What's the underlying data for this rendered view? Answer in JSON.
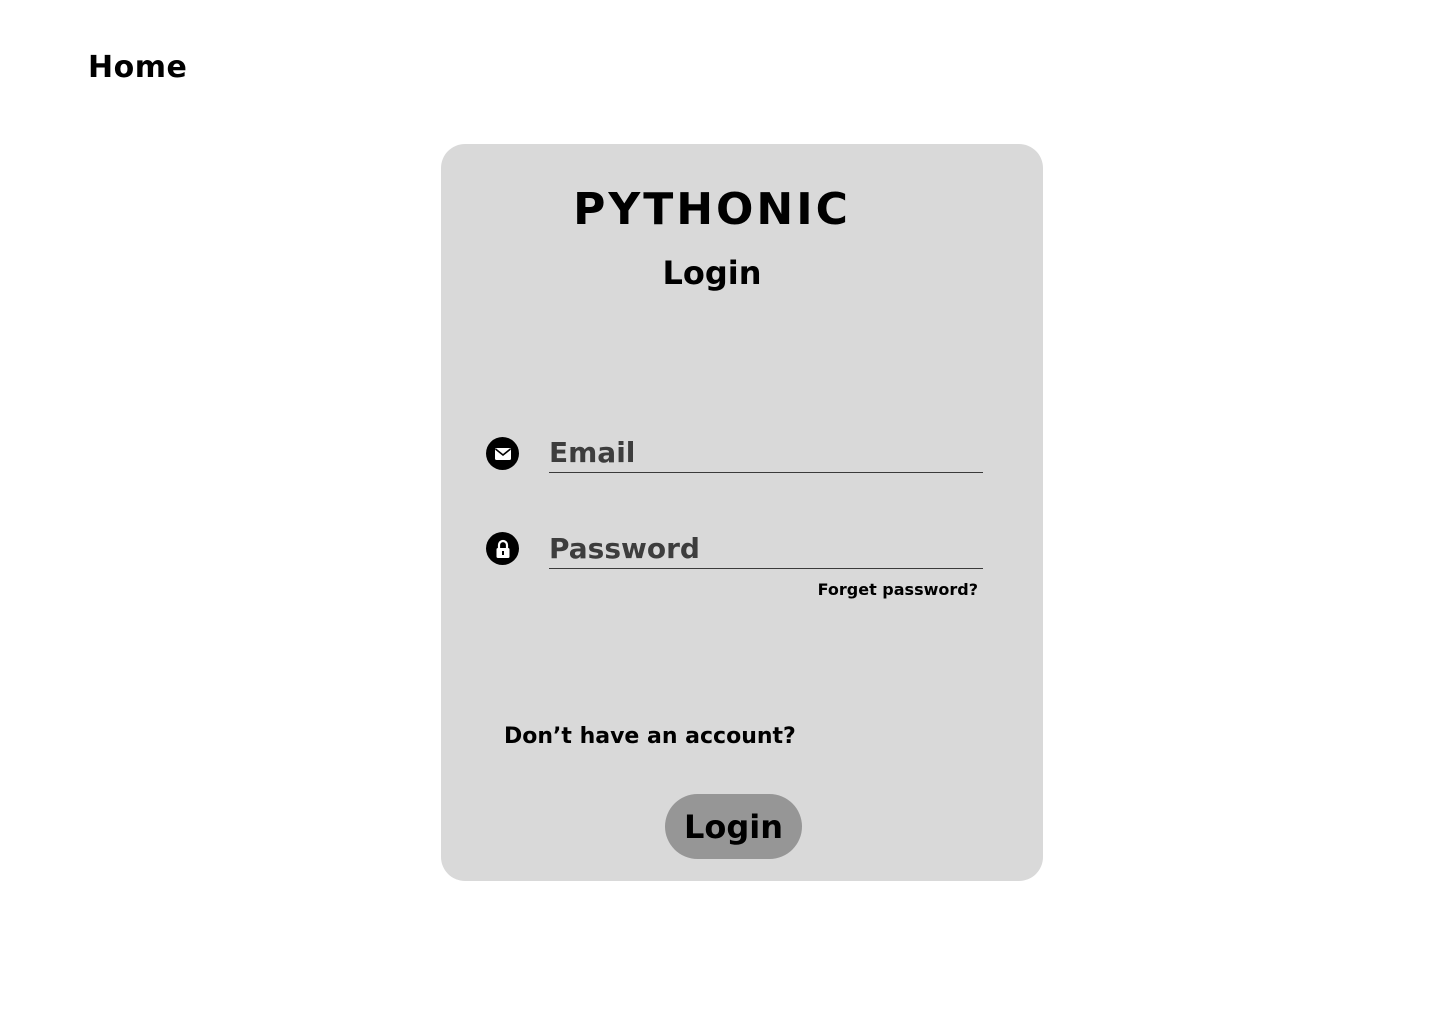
{
  "nav": {
    "home_label": "Home"
  },
  "card": {
    "brand": "PYTHONIC",
    "title": "Login"
  },
  "form": {
    "email_placeholder": "Email",
    "email_value": "",
    "password_placeholder": "Password",
    "password_value": "",
    "forgot_label": "Forget password?",
    "no_account_label": "Don’t have an account?",
    "login_label": "Login"
  },
  "icons": {
    "email": "envelope-icon",
    "password": "lock-icon"
  },
  "colors": {
    "card_background": "#d9d9d9",
    "button_background": "#969696",
    "page_background": "#ffffff",
    "text": "#000000"
  }
}
